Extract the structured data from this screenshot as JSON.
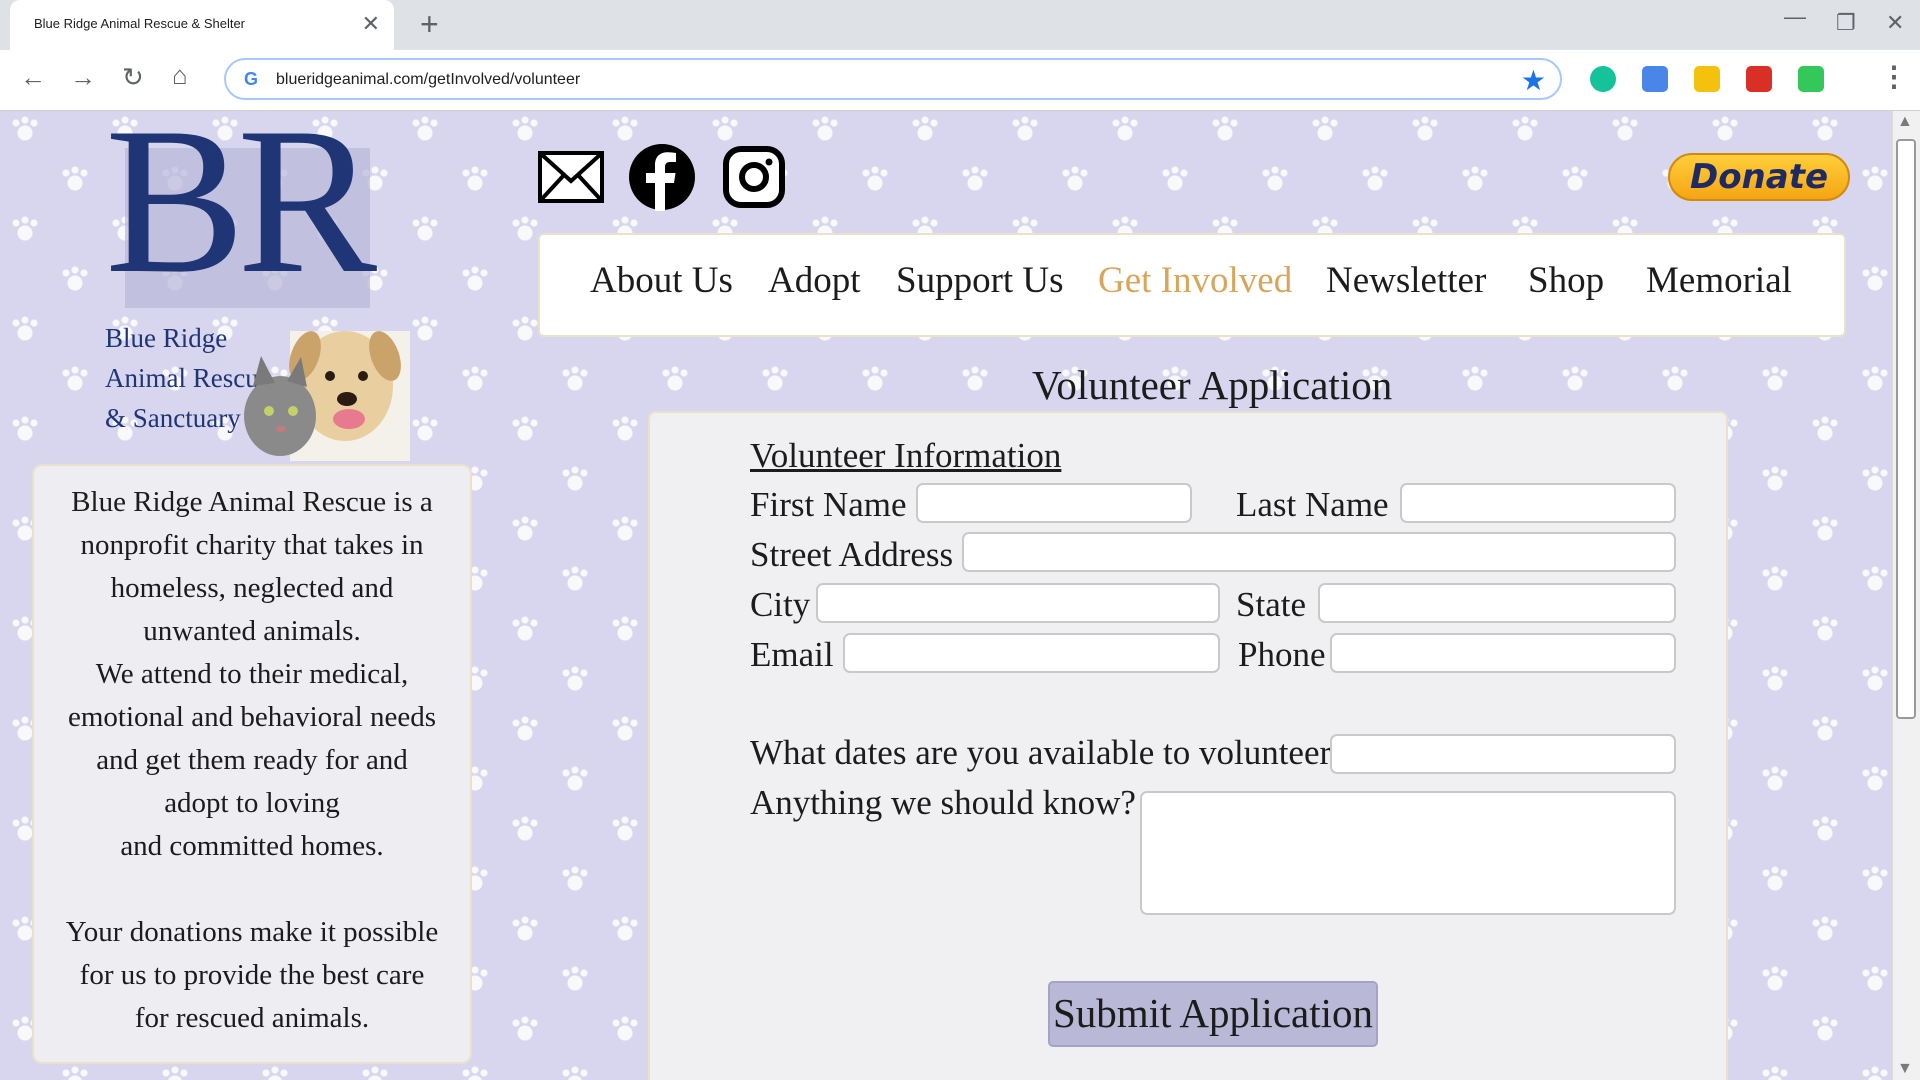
{
  "browser": {
    "tab_title": "Blue Ridge Animal Rescue & Shelter",
    "url": "blueridgeanimal.com/getInvolved/volunteer"
  },
  "logo": {
    "letters": "BR",
    "line1": "Blue Ridge",
    "line2": "Animal Rescue",
    "line3": "& Sanctuary"
  },
  "intro": {
    "paragraph1": [
      "Blue Ridge Animal Rescue is a",
      "nonprofit charity that takes in",
      "homeless, neglected and",
      "unwanted animals.",
      "We attend to their medical,",
      "emotional and behavioral needs",
      "and get them ready for and",
      "adopt to loving",
      "and committed homes."
    ],
    "paragraph2": [
      "Your donations make it possible",
      "for us to provide the best care",
      "for rescued animals."
    ]
  },
  "donate_label": "Donate",
  "nav": {
    "items": [
      "About Us",
      "Adopt",
      "Support Us",
      "Get Involved",
      "Newsletter",
      "Shop",
      "Memorial"
    ],
    "active": "Get Involved"
  },
  "form": {
    "title": "Volunteer Application",
    "section_heading": "Volunteer Information",
    "first_name": "First Name",
    "last_name": "Last Name",
    "street_address": "Street Address",
    "city": "City",
    "state": "State",
    "email": "Email",
    "phone": "Phone",
    "dates_question": "What dates are you available to volunteer?",
    "notes_question": "Anything we should know?",
    "submit_label": "Submit Application"
  },
  "colors": {
    "page_background": "#d7d6ee",
    "logo_blue": "#1f3576",
    "nav_active": "#d7a65a",
    "donate_yellow": "#f6a514",
    "submit_button": "#b9b8d6"
  }
}
